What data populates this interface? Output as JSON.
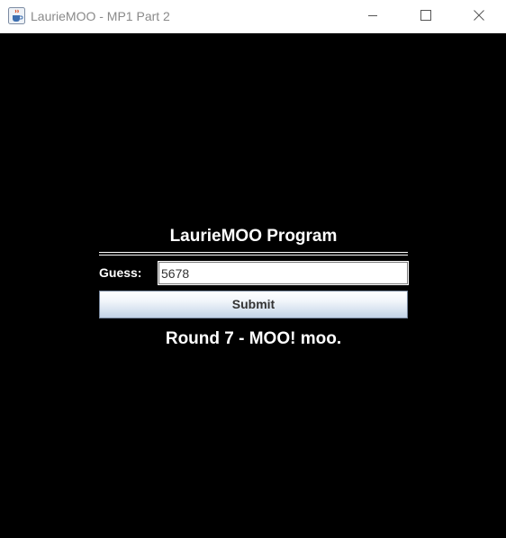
{
  "window": {
    "title": "LaurieMOO - MP1 Part 2",
    "icon": "java-coffee-icon",
    "controls": [
      "minimize-icon",
      "maximize-icon",
      "close-icon"
    ]
  },
  "panel": {
    "heading": "LaurieMOO Program",
    "guess_label": "Guess:",
    "guess_value": "5678",
    "submit_label": "Submit",
    "status_text": "Round 7 - MOO! moo."
  },
  "colors": {
    "background": "#000000",
    "text": "#ffffff",
    "titlebar": "#ffffff",
    "title_text": "#8a8a8a"
  }
}
